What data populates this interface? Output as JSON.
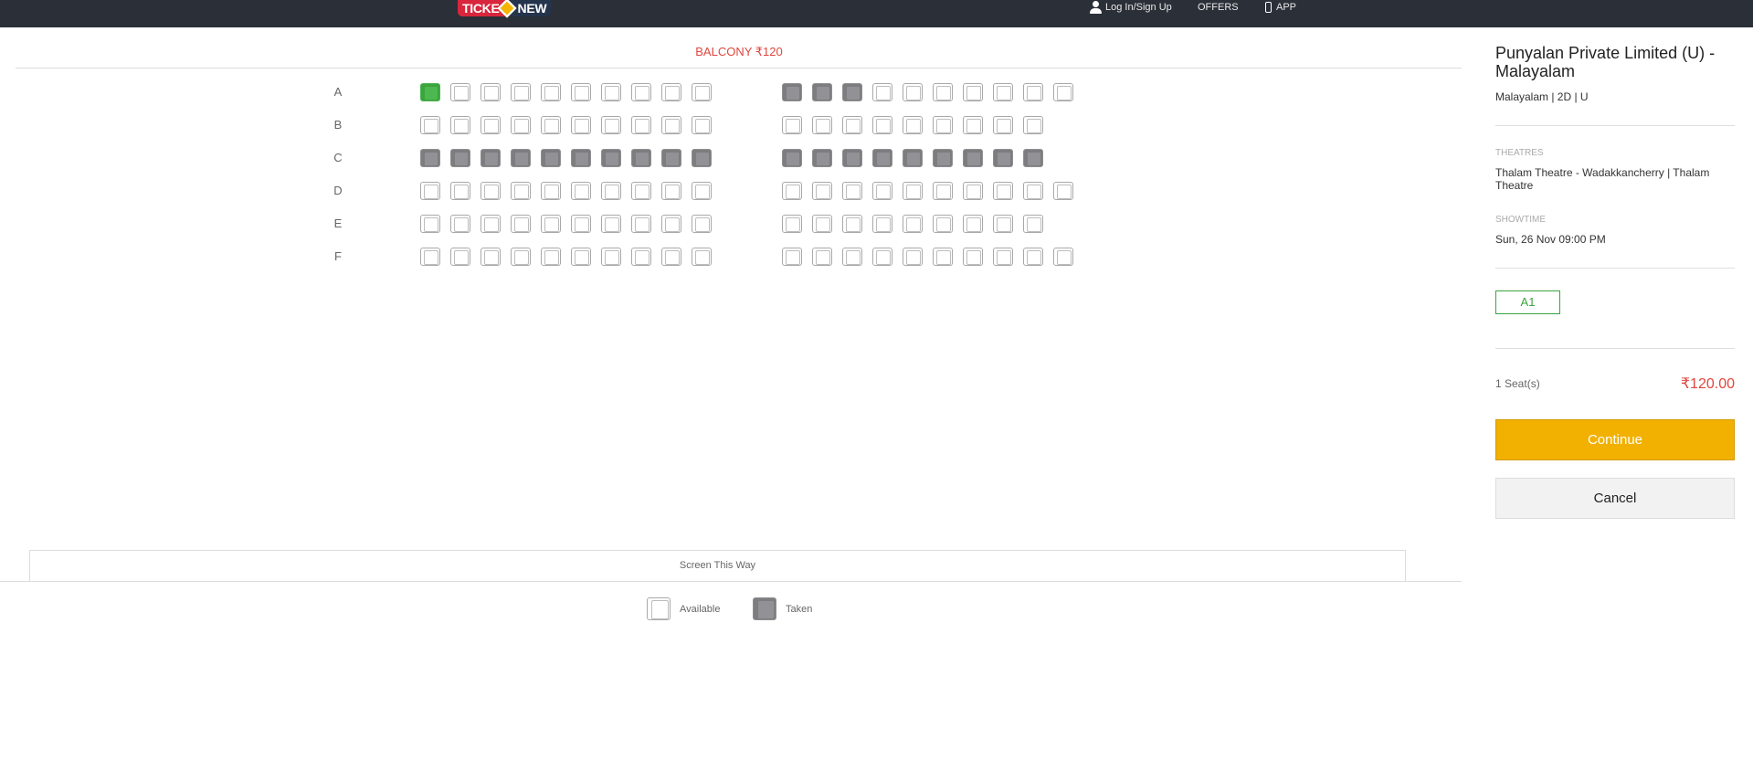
{
  "header": {
    "logo_left": "TICKE",
    "logo_right": "NEW",
    "login_label": "Log In/Sign Up",
    "offers_label": "OFFERS",
    "app_label": "APP"
  },
  "seat_map": {
    "section_title": "BALCONY ₹120",
    "rows": [
      {
        "label": "A",
        "left": [
          "selected",
          "available",
          "available",
          "available",
          "available",
          "available",
          "available",
          "available",
          "available",
          "available"
        ],
        "right": [
          "taken",
          "taken",
          "taken",
          "available",
          "available",
          "available",
          "available",
          "available",
          "available",
          "available"
        ]
      },
      {
        "label": "B",
        "left": [
          "available",
          "available",
          "available",
          "available",
          "available",
          "available",
          "available",
          "available",
          "available",
          "available"
        ],
        "right": [
          "available",
          "available",
          "available",
          "available",
          "available",
          "available",
          "available",
          "available",
          "available"
        ]
      },
      {
        "label": "C",
        "left": [
          "taken",
          "taken",
          "taken",
          "taken",
          "taken",
          "taken",
          "taken",
          "taken",
          "taken",
          "taken"
        ],
        "right": [
          "taken",
          "taken",
          "taken",
          "taken",
          "taken",
          "taken",
          "taken",
          "taken",
          "taken"
        ]
      },
      {
        "label": "D",
        "left": [
          "available",
          "available",
          "available",
          "available",
          "available",
          "available",
          "available",
          "available",
          "available",
          "available"
        ],
        "right": [
          "available",
          "available",
          "available",
          "available",
          "available",
          "available",
          "available",
          "available",
          "available",
          "available"
        ]
      },
      {
        "label": "E",
        "left": [
          "available",
          "available",
          "available",
          "available",
          "available",
          "available",
          "available",
          "available",
          "available",
          "available"
        ],
        "right": [
          "available",
          "available",
          "available",
          "available",
          "available",
          "available",
          "available",
          "available",
          "available"
        ]
      },
      {
        "label": "F",
        "left": [
          "available",
          "available",
          "available",
          "available",
          "available",
          "available",
          "available",
          "available",
          "available",
          "available"
        ],
        "right": [
          "available",
          "available",
          "available",
          "available",
          "available",
          "available",
          "available",
          "available",
          "available",
          "available"
        ]
      }
    ],
    "screen_label": "Screen This Way",
    "legend": {
      "available": "Available",
      "taken": "Taken"
    }
  },
  "summary": {
    "movie_title": "Punyalan Private Limited (U) - Malayalam",
    "meta": "Malayalam | 2D | U",
    "theatres_label": "THEATRES",
    "theatre": "Thalam Theatre - Wadakkancherry | Thalam Theatre",
    "showtime_label": "SHOWTIME",
    "showtime": "Sun, 26 Nov 09:00 PM",
    "selected_seat": "A1",
    "seat_count": "1 Seat(s)",
    "price": "₹120.00",
    "continue_label": "Continue",
    "cancel_label": "Cancel"
  },
  "colors": {
    "topbar": "#2b2f38",
    "accent_red": "#e0463e",
    "selected_green": "#3aa43d",
    "taken_gray": "#7d7d80",
    "continue_yellow": "#f2b100"
  }
}
